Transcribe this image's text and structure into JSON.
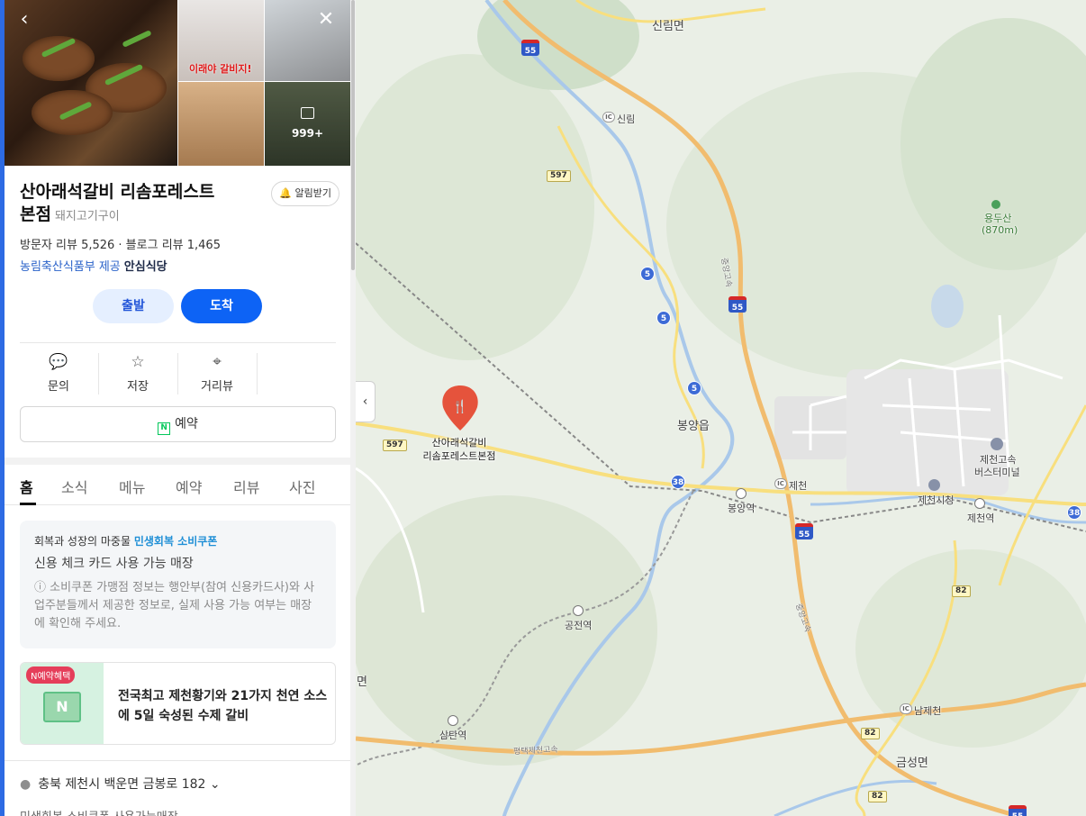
{
  "place": {
    "name_line1": "산아래석갈비 리솜포레스트",
    "name_line2": "본점",
    "category": "돼지고기구이",
    "reviews": "방문자 리뷰 5,526 · 블로그 리뷰 1,465",
    "cert_source": "농림축산식품부 제공",
    "cert_label": "안심식당",
    "alarm_label": "알림받기",
    "photo_count": "999+",
    "photo_overlay_text": "이래야 갈비지!"
  },
  "actions": {
    "depart": "출발",
    "arrive": "도착",
    "inquiry": "문의",
    "save": "저장",
    "street_view": "거리뷰",
    "reserve": "예약"
  },
  "tabs": [
    "홈",
    "소식",
    "메뉴",
    "예약",
    "리뷰",
    "사진"
  ],
  "coupon": {
    "intro": "회복과 성장의 마중물",
    "highlight": "민생회복 소비쿠폰",
    "line2": "신용 체크 카드 사용 가능 매장",
    "note": "ⓘ 소비쿠폰 가맹점 정보는 행안부(참여 신용카드사)와 사업주분들께서 제공한 정보로, 실제 사용 가능 여부는 매장에 확인해 주세요."
  },
  "promo": {
    "badge": "N예약혜택",
    "text": "전국최고 제천황기와 21가지 천연 소스에 5일 숙성된 수제 갈비"
  },
  "address": {
    "text": "충북 제천시 백운면 금봉로 182",
    "next": "민생회복 소비쿠폰 사용가능매장"
  },
  "map": {
    "marker_label_1": "산아래석갈비",
    "marker_label_2": "리솜포레스트본점",
    "labels": {
      "sinrim_myeon": "신림면",
      "sinrim_ic": "신림",
      "yongdusan": "용두산",
      "yongdusan_elev": "(870m)",
      "bongyang_eup": "봉양읍",
      "bongyang_station": "봉양역",
      "jecheon_ic": "제천",
      "jecheon_terminal_1": "제천고속",
      "jecheon_terminal_2": "버스터미널",
      "jecheon_cityhall": "제천시청",
      "jecheon_station": "제천역",
      "gongjeon_station": "공전역",
      "samtan_station": "삼탄역",
      "namjecheon_ic": "남제천",
      "geumseong_myeon": "금성면",
      "myeon_fragment": "면",
      "jungang_expwy": "중앙고속",
      "pyeongtaek_jecheon_expwy": "평택제천고속"
    },
    "route_numbers": {
      "r55": "55",
      "r597": "597",
      "r5": "5",
      "r38": "38",
      "r82": "82"
    },
    "ic_badge": "IC"
  }
}
